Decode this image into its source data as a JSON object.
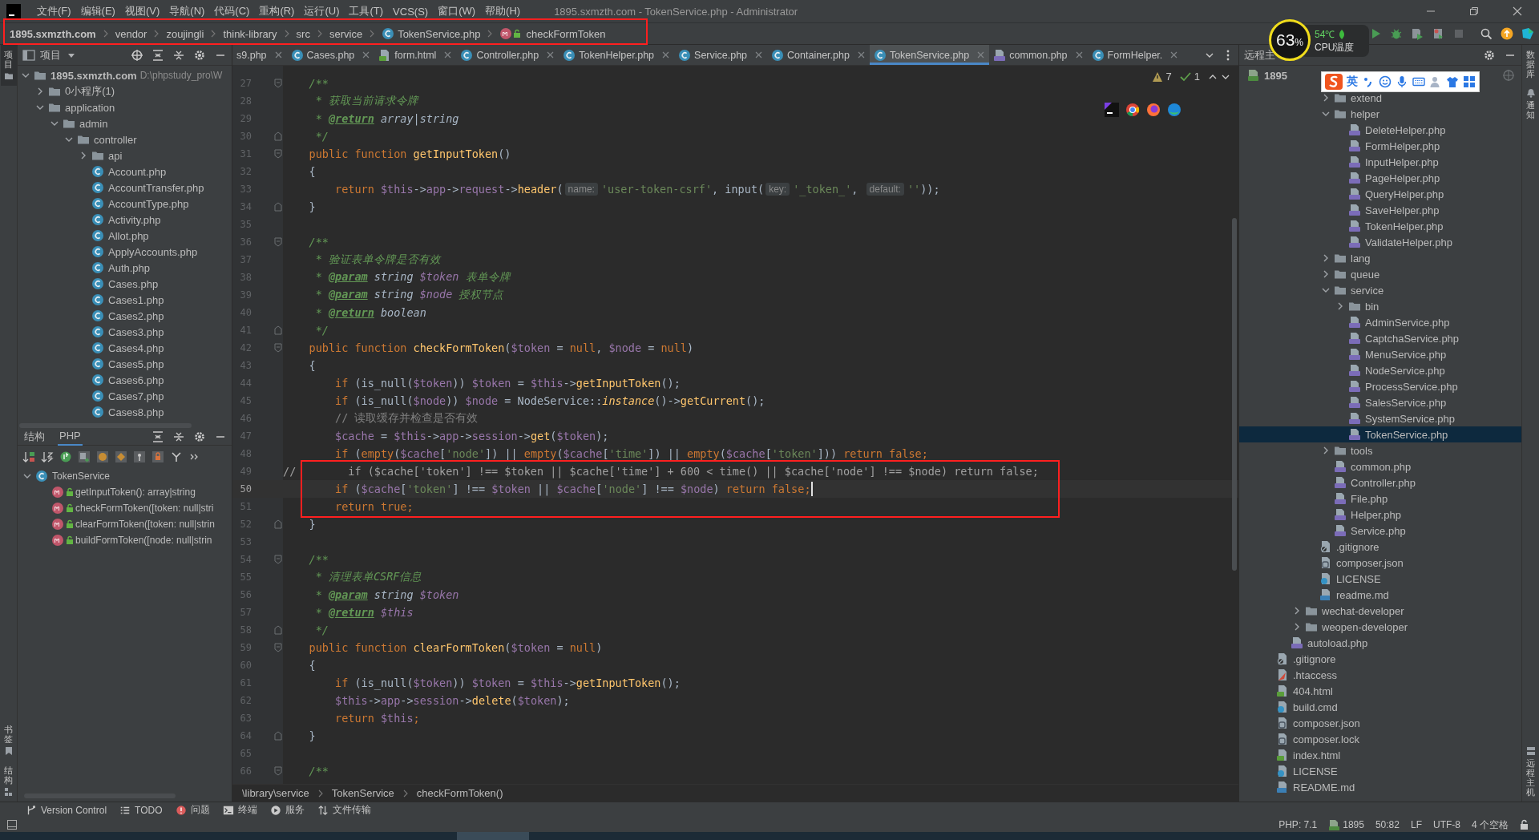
{
  "window": {
    "title": "1895.sxmzth.com - TokenService.php - Administrator"
  },
  "menu": [
    "文件(F)",
    "编辑(E)",
    "视图(V)",
    "导航(N)",
    "代码(C)",
    "重构(R)",
    "运行(U)",
    "工具(T)",
    "VCS(S)",
    "窗口(W)",
    "帮助(H)"
  ],
  "nav": {
    "framed": true,
    "crumbs": [
      {
        "text": "1895.sxmzth.com",
        "kind": "plain"
      },
      {
        "text": "vendor",
        "kind": "plain"
      },
      {
        "text": "zoujingli",
        "kind": "plain"
      },
      {
        "text": "think-library",
        "kind": "plain"
      },
      {
        "text": "src",
        "kind": "plain"
      },
      {
        "text": "service",
        "kind": "plain"
      },
      {
        "text": "TokenService.php",
        "kind": "class"
      },
      {
        "text": "checkFormToken",
        "kind": "method"
      }
    ]
  },
  "cpu": {
    "value": "63",
    "unit": "%",
    "temp": "54℃",
    "label": "CPU温度"
  },
  "left_strip": {
    "top": [
      {
        "label": "项目",
        "selected": true
      }
    ],
    "bottom": [
      {
        "label": "书签",
        "selected": false
      },
      {
        "label": "结构",
        "selected": false
      }
    ]
  },
  "right_strip": {
    "top": [
      {
        "label": "数据库",
        "selected": false
      },
      {
        "label": "通知",
        "selected": false
      }
    ],
    "bottom": [
      {
        "label": "远程主机",
        "selected": false
      }
    ]
  },
  "project": {
    "title": "项目",
    "tree": [
      {
        "label": "1895.sxmzth.com",
        "path": "D:\\phpstudy_pro\\W",
        "kind": "module",
        "expanded": true,
        "children": [
          {
            "label": "0小程序(1)",
            "kind": "folder",
            "expanded": false
          },
          {
            "label": "application",
            "kind": "folder",
            "expanded": true,
            "children": [
              {
                "label": "admin",
                "kind": "folder",
                "expanded": true,
                "children": [
                  {
                    "label": "controller",
                    "kind": "folder",
                    "expanded": true,
                    "children": [
                      {
                        "label": "api",
                        "kind": "folder",
                        "expanded": false
                      },
                      {
                        "label": "Account.php",
                        "kind": "class"
                      },
                      {
                        "label": "AccountTransfer.php",
                        "kind": "class"
                      },
                      {
                        "label": "AccountType.php",
                        "kind": "class"
                      },
                      {
                        "label": "Activity.php",
                        "kind": "class"
                      },
                      {
                        "label": "Allot.php",
                        "kind": "class"
                      },
                      {
                        "label": "ApplyAccounts.php",
                        "kind": "class"
                      },
                      {
                        "label": "Auth.php",
                        "kind": "class"
                      },
                      {
                        "label": "Cases.php",
                        "kind": "class"
                      },
                      {
                        "label": "Cases1.php",
                        "kind": "class"
                      },
                      {
                        "label": "Cases2.php",
                        "kind": "class"
                      },
                      {
                        "label": "Cases3.php",
                        "kind": "class"
                      },
                      {
                        "label": "Cases4.php",
                        "kind": "class"
                      },
                      {
                        "label": "Cases5.php",
                        "kind": "class"
                      },
                      {
                        "label": "Cases6.php",
                        "kind": "class"
                      },
                      {
                        "label": "Cases7.php",
                        "kind": "class"
                      },
                      {
                        "label": "Cases8.php",
                        "kind": "class"
                      }
                    ]
                  }
                ]
              }
            ]
          }
        ]
      }
    ]
  },
  "structure": {
    "tabs": [
      {
        "label": "结构",
        "selected": false
      },
      {
        "label": "PHP",
        "selected": true
      }
    ],
    "tree": [
      {
        "label": "TokenService",
        "kind": "class",
        "expanded": true,
        "children": [
          {
            "label": "getInputToken(): array|string",
            "kind": "method"
          },
          {
            "label": "checkFormToken([token: null|stri",
            "kind": "method"
          },
          {
            "label": "clearFormToken([token: null|strin",
            "kind": "method"
          },
          {
            "label": "buildFormToken([node: null|strin",
            "kind": "method"
          }
        ]
      }
    ]
  },
  "editor": {
    "tabs": [
      {
        "label": "s9.php",
        "kind": "plain",
        "selected": false
      },
      {
        "label": "Cases.php",
        "kind": "class",
        "selected": false
      },
      {
        "label": "form.html",
        "kind": "html",
        "selected": false
      },
      {
        "label": "Controller.php",
        "kind": "class",
        "selected": false
      },
      {
        "label": "TokenHelper.php",
        "kind": "class",
        "selected": false
      },
      {
        "label": "Service.php",
        "kind": "class",
        "selected": false
      },
      {
        "label": "Container.php",
        "kind": "class",
        "selected": false
      },
      {
        "label": "TokenService.php",
        "kind": "class",
        "selected": true
      },
      {
        "label": "common.php",
        "kind": "php",
        "selected": false
      },
      {
        "label": "FormHelper.",
        "kind": "class",
        "selected": false
      }
    ],
    "inspections": {
      "warnings": "7",
      "checks": "1"
    },
    "lines": [
      {
        "num": "27",
        "fold_start": true,
        "fold_end": false,
        "current": false,
        "framed": false,
        "segs": [
          {
            "kind": "doc",
            "text": "    /**"
          }
        ]
      },
      {
        "num": "28",
        "fold_start": false,
        "fold_end": false,
        "current": false,
        "framed": false,
        "segs": [
          {
            "kind": "doc",
            "text": "     * 获取当前请求令牌"
          }
        ]
      },
      {
        "num": "29",
        "fold_start": false,
        "fold_end": false,
        "current": false,
        "framed": false,
        "segs": [
          {
            "kind": "doc",
            "text": "     * "
          },
          {
            "kind": "tag",
            "text": "@return"
          },
          {
            "kind": "dtype",
            "text": " array|string"
          }
        ]
      },
      {
        "num": "30",
        "fold_start": false,
        "fold_end": true,
        "current": false,
        "framed": false,
        "segs": [
          {
            "kind": "doc",
            "text": "     */"
          }
        ]
      },
      {
        "num": "31",
        "fold_start": true,
        "fold_end": false,
        "current": false,
        "framed": false,
        "segs": [
          {
            "kind": "kw",
            "text": "    public function "
          },
          {
            "kind": "fn",
            "text": "getInputToken"
          },
          {
            "kind": "p",
            "text": "()"
          }
        ]
      },
      {
        "num": "32",
        "fold_start": false,
        "fold_end": false,
        "current": false,
        "framed": false,
        "segs": [
          {
            "kind": "p",
            "text": "    {"
          }
        ]
      },
      {
        "num": "33",
        "fold_start": false,
        "fold_end": false,
        "current": false,
        "framed": false,
        "segs": [
          {
            "kind": "kw",
            "text": "        return "
          },
          {
            "kind": "var",
            "text": "$this"
          },
          {
            "kind": "p",
            "text": "->"
          },
          {
            "kind": "fld",
            "text": "app"
          },
          {
            "kind": "p",
            "text": "->"
          },
          {
            "kind": "fld",
            "text": "request"
          },
          {
            "kind": "p",
            "text": "->"
          },
          {
            "kind": "call",
            "text": "header"
          },
          {
            "kind": "p",
            "text": "("
          },
          {
            "kind": "hint",
            "text": "name:"
          },
          {
            "kind": "str",
            "text": "'user-token-csrf'"
          },
          {
            "kind": "p",
            "text": ", input("
          },
          {
            "kind": "hint",
            "text": "key:"
          },
          {
            "kind": "str",
            "text": "'_token_'"
          },
          {
            "kind": "p",
            "text": ", "
          },
          {
            "kind": "hint",
            "text": "default:"
          },
          {
            "kind": "str",
            "text": "''"
          },
          {
            "kind": "p",
            "text": "));"
          }
        ]
      },
      {
        "num": "34",
        "fold_start": false,
        "fold_end": true,
        "current": false,
        "framed": false,
        "segs": [
          {
            "kind": "p",
            "text": "    }"
          }
        ]
      },
      {
        "num": "35",
        "fold_start": false,
        "fold_end": false,
        "current": false,
        "framed": false
      },
      {
        "num": "36",
        "fold_start": true,
        "fold_end": false,
        "current": false,
        "framed": false,
        "segs": [
          {
            "kind": "doc",
            "text": "    /**"
          }
        ]
      },
      {
        "num": "37",
        "fold_start": false,
        "fold_end": false,
        "current": false,
        "framed": false,
        "segs": [
          {
            "kind": "doc",
            "text": "     * 验证表单令牌是否有效"
          }
        ]
      },
      {
        "num": "38",
        "fold_start": false,
        "fold_end": false,
        "current": false,
        "framed": false,
        "segs": [
          {
            "kind": "doc",
            "text": "     * "
          },
          {
            "kind": "tag",
            "text": "@param"
          },
          {
            "kind": "dtype",
            "text": " string "
          },
          {
            "kind": "dvar",
            "text": "$token"
          },
          {
            "kind": "doc",
            "text": " 表单令牌"
          }
        ]
      },
      {
        "num": "39",
        "fold_start": false,
        "fold_end": false,
        "current": false,
        "framed": false,
        "segs": [
          {
            "kind": "doc",
            "text": "     * "
          },
          {
            "kind": "tag",
            "text": "@param"
          },
          {
            "kind": "dtype",
            "text": " string "
          },
          {
            "kind": "dvar",
            "text": "$node"
          },
          {
            "kind": "doc",
            "text": " 授权节点"
          }
        ]
      },
      {
        "num": "40",
        "fold_start": false,
        "fold_end": false,
        "current": false,
        "framed": false,
        "segs": [
          {
            "kind": "doc",
            "text": "     * "
          },
          {
            "kind": "tag",
            "text": "@return"
          },
          {
            "kind": "dtype",
            "text": " boolean"
          }
        ]
      },
      {
        "num": "41",
        "fold_start": false,
        "fold_end": true,
        "current": false,
        "framed": false,
        "segs": [
          {
            "kind": "doc",
            "text": "     */"
          }
        ]
      },
      {
        "num": "42",
        "fold_start": true,
        "fold_end": false,
        "current": false,
        "framed": false,
        "segs": [
          {
            "kind": "kw",
            "text": "    public function "
          },
          {
            "kind": "fn",
            "text": "checkFormToken"
          },
          {
            "kind": "p",
            "text": "("
          },
          {
            "kind": "var",
            "text": "$token"
          },
          {
            "kind": "p",
            "text": " = "
          },
          {
            "kind": "kw",
            "text": "null"
          },
          {
            "kind": "p",
            "text": ", "
          },
          {
            "kind": "var",
            "text": "$node"
          },
          {
            "kind": "p",
            "text": " = "
          },
          {
            "kind": "kw",
            "text": "null"
          },
          {
            "kind": "p",
            "text": ")"
          }
        ]
      },
      {
        "num": "43",
        "fold_start": false,
        "fold_end": false,
        "current": false,
        "framed": false,
        "segs": [
          {
            "kind": "p",
            "text": "    {"
          }
        ]
      },
      {
        "num": "44",
        "fold_start": false,
        "fold_end": false,
        "current": false,
        "framed": false,
        "segs": [
          {
            "kind": "kw",
            "text": "        if"
          },
          {
            "kind": "p",
            "text": " (is_null("
          },
          {
            "kind": "var",
            "text": "$token"
          },
          {
            "kind": "p",
            "text": ")) "
          },
          {
            "kind": "var",
            "text": "$token"
          },
          {
            "kind": "p",
            "text": " = "
          },
          {
            "kind": "var",
            "text": "$this"
          },
          {
            "kind": "p",
            "text": "->"
          },
          {
            "kind": "call",
            "text": "getInputToken"
          },
          {
            "kind": "p",
            "text": "();"
          }
        ]
      },
      {
        "num": "45",
        "fold_start": false,
        "fold_end": false,
        "current": false,
        "framed": false,
        "segs": [
          {
            "kind": "kw",
            "text": "        if"
          },
          {
            "kind": "p",
            "text": " (is_null("
          },
          {
            "kind": "var",
            "text": "$node"
          },
          {
            "kind": "p",
            "text": ")) "
          },
          {
            "kind": "var",
            "text": "$node"
          },
          {
            "kind": "p",
            "text": " = NodeService::"
          },
          {
            "kind": "sfn",
            "text": "instance"
          },
          {
            "kind": "p",
            "text": "()->"
          },
          {
            "kind": "call",
            "text": "getCurrent"
          },
          {
            "kind": "p",
            "text": "();"
          }
        ]
      },
      {
        "num": "46",
        "fold_start": false,
        "fold_end": false,
        "current": false,
        "framed": false,
        "segs": [
          {
            "kind": "cmt",
            "text": "        // 读取缓存并检查是否有效"
          }
        ]
      },
      {
        "num": "47",
        "fold_start": false,
        "fold_end": false,
        "current": false,
        "framed": false,
        "segs": [
          {
            "kind": "var",
            "text": "        $cache"
          },
          {
            "kind": "p",
            "text": " = "
          },
          {
            "kind": "var",
            "text": "$this"
          },
          {
            "kind": "p",
            "text": "->"
          },
          {
            "kind": "fld",
            "text": "app"
          },
          {
            "kind": "p",
            "text": "->"
          },
          {
            "kind": "fld",
            "text": "session"
          },
          {
            "kind": "p",
            "text": "->"
          },
          {
            "kind": "call",
            "text": "get"
          },
          {
            "kind": "p",
            "text": "("
          },
          {
            "kind": "var",
            "text": "$token"
          },
          {
            "kind": "p",
            "text": ");"
          }
        ]
      },
      {
        "num": "48",
        "fold_start": false,
        "fold_end": false,
        "current": false,
        "framed": false,
        "segs": [
          {
            "kind": "kw",
            "text": "        if"
          },
          {
            "kind": "p",
            "text": " ("
          },
          {
            "kind": "kw",
            "text": "empty"
          },
          {
            "kind": "p",
            "text": "("
          },
          {
            "kind": "var",
            "text": "$cache"
          },
          {
            "kind": "p",
            "text": "["
          },
          {
            "kind": "str",
            "text": "'node'"
          },
          {
            "kind": "p",
            "text": "]) || "
          },
          {
            "kind": "kw",
            "text": "empty"
          },
          {
            "kind": "p",
            "text": "("
          },
          {
            "kind": "var",
            "text": "$cache"
          },
          {
            "kind": "p",
            "text": "["
          },
          {
            "kind": "str",
            "text": "'time'"
          },
          {
            "kind": "p",
            "text": "]) || "
          },
          {
            "kind": "kw",
            "text": "empty"
          },
          {
            "kind": "p",
            "text": "("
          },
          {
            "kind": "var",
            "text": "$cache"
          },
          {
            "kind": "p",
            "text": "["
          },
          {
            "kind": "str",
            "text": "'token'"
          },
          {
            "kind": "p",
            "text": "])) "
          },
          {
            "kind": "kw",
            "text": "return false;"
          }
        ]
      },
      {
        "num": "49",
        "fold_start": false,
        "fold_end": false,
        "current": false,
        "framed": true,
        "segs": [
          {
            "kind": "cmt2",
            "text": "//        if ($cache['token'] !== $token || $cache['time'] + 600 < time() || $cache['node'] !== $node) return false;"
          }
        ]
      },
      {
        "num": "50",
        "fold_start": false,
        "fold_end": false,
        "current": true,
        "framed": true,
        "segs": [
          {
            "kind": "kw",
            "text": "        if"
          },
          {
            "kind": "p",
            "text": " ("
          },
          {
            "kind": "var",
            "text": "$cache"
          },
          {
            "kind": "p",
            "text": "["
          },
          {
            "kind": "str",
            "text": "'token'"
          },
          {
            "kind": "p",
            "text": "] !== "
          },
          {
            "kind": "var",
            "text": "$token"
          },
          {
            "kind": "p",
            "text": " || "
          },
          {
            "kind": "var",
            "text": "$cache"
          },
          {
            "kind": "p",
            "text": "["
          },
          {
            "kind": "str",
            "text": "'node'"
          },
          {
            "kind": "p",
            "text": "] !== "
          },
          {
            "kind": "var",
            "text": "$node"
          },
          {
            "kind": "p",
            "text": ") "
          },
          {
            "kind": "kw",
            "text": "return false;"
          }
        ]
      },
      {
        "num": "51",
        "fold_start": false,
        "fold_end": false,
        "current": false,
        "framed": true,
        "segs": [
          {
            "kind": "kw",
            "text": "        return true;"
          }
        ]
      },
      {
        "num": "52",
        "fold_start": false,
        "fold_end": true,
        "current": false,
        "framed": false,
        "segs": [
          {
            "kind": "p",
            "text": "    }"
          }
        ]
      },
      {
        "num": "53",
        "fold_start": false,
        "fold_end": false,
        "current": false,
        "framed": false
      },
      {
        "num": "54",
        "fold_start": true,
        "fold_end": false,
        "current": false,
        "framed": false,
        "segs": [
          {
            "kind": "doc",
            "text": "    /**"
          }
        ]
      },
      {
        "num": "55",
        "fold_start": false,
        "fold_end": false,
        "current": false,
        "framed": false,
        "segs": [
          {
            "kind": "doc",
            "text": "     * 清理表单CSRF信息"
          }
        ]
      },
      {
        "num": "56",
        "fold_start": false,
        "fold_end": false,
        "current": false,
        "framed": false,
        "segs": [
          {
            "kind": "doc",
            "text": "     * "
          },
          {
            "kind": "tag",
            "text": "@param"
          },
          {
            "kind": "dtype",
            "text": " string "
          },
          {
            "kind": "dvar",
            "text": "$token"
          }
        ]
      },
      {
        "num": "57",
        "fold_start": false,
        "fold_end": false,
        "current": false,
        "framed": false,
        "segs": [
          {
            "kind": "doc",
            "text": "     * "
          },
          {
            "kind": "tag",
            "text": "@return"
          },
          {
            "kind": "dvar",
            "text": " $this"
          }
        ]
      },
      {
        "num": "58",
        "fold_start": false,
        "fold_end": true,
        "current": false,
        "framed": false,
        "segs": [
          {
            "kind": "doc",
            "text": "     */"
          }
        ]
      },
      {
        "num": "59",
        "fold_start": true,
        "fold_end": false,
        "current": false,
        "framed": false,
        "segs": [
          {
            "kind": "kw",
            "text": "    public function "
          },
          {
            "kind": "fn",
            "text": "clearFormToken"
          },
          {
            "kind": "p",
            "text": "("
          },
          {
            "kind": "var",
            "text": "$token"
          },
          {
            "kind": "p",
            "text": " = "
          },
          {
            "kind": "kw",
            "text": "null"
          },
          {
            "kind": "p",
            "text": ")"
          }
        ]
      },
      {
        "num": "60",
        "fold_start": false,
        "fold_end": false,
        "current": false,
        "framed": false,
        "segs": [
          {
            "kind": "p",
            "text": "    {"
          }
        ]
      },
      {
        "num": "61",
        "fold_start": false,
        "fold_end": false,
        "current": false,
        "framed": false,
        "segs": [
          {
            "kind": "kw",
            "text": "        if"
          },
          {
            "kind": "p",
            "text": " (is_null("
          },
          {
            "kind": "var",
            "text": "$token"
          },
          {
            "kind": "p",
            "text": ")) "
          },
          {
            "kind": "var",
            "text": "$token"
          },
          {
            "kind": "p",
            "text": " = "
          },
          {
            "kind": "var",
            "text": "$this"
          },
          {
            "kind": "p",
            "text": "->"
          },
          {
            "kind": "call",
            "text": "getInputToken"
          },
          {
            "kind": "p",
            "text": "();"
          }
        ]
      },
      {
        "num": "62",
        "fold_start": false,
        "fold_end": false,
        "current": false,
        "framed": false,
        "segs": [
          {
            "kind": "var",
            "text": "        $this"
          },
          {
            "kind": "p",
            "text": "->"
          },
          {
            "kind": "fld",
            "text": "app"
          },
          {
            "kind": "p",
            "text": "->"
          },
          {
            "kind": "fld",
            "text": "session"
          },
          {
            "kind": "p",
            "text": "->"
          },
          {
            "kind": "call",
            "text": "delete"
          },
          {
            "kind": "p",
            "text": "("
          },
          {
            "kind": "var",
            "text": "$token"
          },
          {
            "kind": "p",
            "text": ");"
          }
        ]
      },
      {
        "num": "63",
        "fold_start": false,
        "fold_end": false,
        "current": false,
        "framed": false,
        "segs": [
          {
            "kind": "kw",
            "text": "        return "
          },
          {
            "kind": "var",
            "text": "$this"
          },
          {
            "kind": "kw",
            "text": ";"
          }
        ]
      },
      {
        "num": "64",
        "fold_start": false,
        "fold_end": true,
        "current": false,
        "framed": false,
        "segs": [
          {
            "kind": "p",
            "text": "    }"
          }
        ]
      },
      {
        "num": "65",
        "fold_start": false,
        "fold_end": false,
        "current": false,
        "framed": false
      },
      {
        "num": "66",
        "fold_start": true,
        "fold_end": false,
        "current": false,
        "framed": false,
        "segs": [
          {
            "kind": "doc",
            "text": "    /**"
          }
        ]
      }
    ],
    "path": [
      "\\library\\service",
      "TokenService",
      "checkFormToken()"
    ]
  },
  "remote": {
    "title": "远程主",
    "host": "1895",
    "ime": {
      "mode": "英"
    },
    "segments": [
      {
        "items": [
          {
            "label": "extend",
            "kind": "folder",
            "expanded": false,
            "selected": false
          },
          {
            "label": "helper",
            "kind": "folder",
            "expanded": true,
            "selected": false,
            "children": [
              {
                "label": "DeleteHelper.php",
                "kind": "php",
                "selected": false
              },
              {
                "label": "FormHelper.php",
                "kind": "php",
                "selected": false
              },
              {
                "label": "InputHelper.php",
                "kind": "php",
                "selected": false
              },
              {
                "label": "PageHelper.php",
                "kind": "php",
                "selected": false
              },
              {
                "label": "QueryHelper.php",
                "kind": "php",
                "selected": false
              },
              {
                "label": "SaveHelper.php",
                "kind": "php",
                "selected": false
              },
              {
                "label": "TokenHelper.php",
                "kind": "php",
                "selected": false
              },
              {
                "label": "ValidateHelper.php",
                "kind": "php",
                "selected": false
              }
            ]
          },
          {
            "label": "lang",
            "kind": "folder",
            "expanded": false,
            "selected": false
          },
          {
            "label": "queue",
            "kind": "folder",
            "expanded": false,
            "selected": false
          },
          {
            "label": "service",
            "kind": "folder",
            "expanded": true,
            "selected": false,
            "children": [
              {
                "label": "bin",
                "kind": "folder",
                "expanded": false,
                "selected": false
              },
              {
                "label": "AdminService.php",
                "kind": "php",
                "selected": false
              },
              {
                "label": "CaptchaService.php",
                "kind": "php",
                "selected": false
              },
              {
                "label": "MenuService.php",
                "kind": "php",
                "selected": false
              },
              {
                "label": "NodeService.php",
                "kind": "php",
                "selected": false
              },
              {
                "label": "ProcessService.php",
                "kind": "php",
                "selected": false
              },
              {
                "label": "SalesService.php",
                "kind": "php",
                "selected": false
              },
              {
                "label": "SystemService.php",
                "kind": "php",
                "selected": false
              },
              {
                "label": "TokenService.php",
                "kind": "php",
                "selected": true
              }
            ]
          },
          {
            "label": "tools",
            "kind": "folder",
            "expanded": false,
            "selected": false
          },
          {
            "label": "common.php",
            "kind": "php",
            "selected": false
          },
          {
            "label": "Controller.php",
            "kind": "php",
            "selected": false
          },
          {
            "label": "File.php",
            "kind": "php",
            "selected": false
          },
          {
            "label": "Helper.php",
            "kind": "php",
            "selected": false
          },
          {
            "label": "Service.php",
            "kind": "php",
            "selected": false
          }
        ]
      },
      {
        "items": [
          {
            "label": ".gitignore",
            "kind": "ignore",
            "selected": false
          },
          {
            "label": "composer.json",
            "kind": "json",
            "selected": false
          },
          {
            "label": "LICENSE",
            "kind": "text",
            "selected": false
          },
          {
            "label": "readme.md",
            "kind": "md",
            "selected": false
          }
        ]
      },
      {
        "items": [
          {
            "label": "wechat-developer",
            "kind": "folder",
            "expanded": false,
            "selected": false
          },
          {
            "label": "weopen-developer",
            "kind": "folder",
            "expanded": false,
            "selected": false
          }
        ]
      },
      {
        "items": [
          {
            "label": "autoload.php",
            "kind": "php",
            "selected": false
          }
        ]
      },
      {
        "items": [
          {
            "label": ".gitignore",
            "kind": "ignore",
            "selected": false
          },
          {
            "label": ".htaccess",
            "kind": "htaccess",
            "selected": false
          },
          {
            "label": "404.html",
            "kind": "html",
            "selected": false
          },
          {
            "label": "build.cmd",
            "kind": "text",
            "selected": false
          },
          {
            "label": "composer.json",
            "kind": "json",
            "selected": false
          },
          {
            "label": "composer.lock",
            "kind": "json",
            "selected": false
          },
          {
            "label": "index.html",
            "kind": "html",
            "selected": false
          },
          {
            "label": "LICENSE",
            "kind": "text",
            "selected": false
          },
          {
            "label": "README.md",
            "kind": "md",
            "selected": false
          }
        ]
      }
    ]
  },
  "tool_windows": [
    {
      "label": "Version Control",
      "kind": "vcs"
    },
    {
      "label": "TODO",
      "kind": "list"
    },
    {
      "label": "问题",
      "kind": "problem"
    },
    {
      "label": "终端",
      "kind": "terminal"
    },
    {
      "label": "服务",
      "kind": "service"
    },
    {
      "label": "文件传输",
      "kind": "transfer"
    }
  ],
  "status": {
    "php": "PHP: 7.1",
    "ftp": "1895",
    "position": "50:82",
    "line_sep": "LF",
    "encoding": "UTF-8",
    "indent": "4 个空格"
  }
}
